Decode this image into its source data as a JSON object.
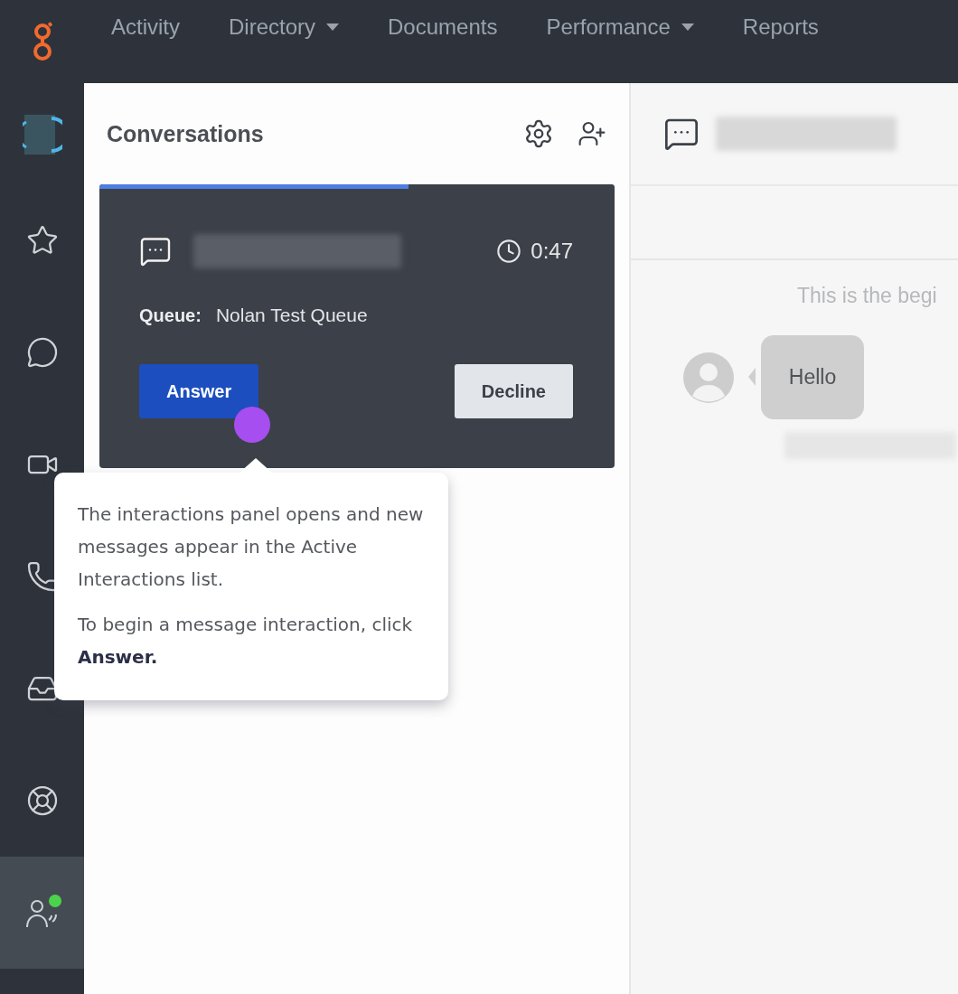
{
  "top_nav": {
    "items": [
      {
        "label": "Activity",
        "has_menu": false
      },
      {
        "label": "Directory",
        "has_menu": true
      },
      {
        "label": "Documents",
        "has_menu": false
      },
      {
        "label": "Performance",
        "has_menu": true
      },
      {
        "label": "Reports",
        "has_menu": false
      }
    ]
  },
  "side_rail": {
    "items": [
      {
        "kind": "star",
        "selected": false
      },
      {
        "kind": "chat",
        "selected": false
      },
      {
        "kind": "video",
        "selected": false
      },
      {
        "kind": "phone",
        "selected": false
      },
      {
        "kind": "inbox",
        "selected": false
      },
      {
        "kind": "help",
        "selected": false
      },
      {
        "kind": "agent",
        "selected": true,
        "color": "#4cd34c"
      }
    ]
  },
  "conversations": {
    "title": "Conversations",
    "alert": {
      "level": 0.6,
      "timer": "0:47",
      "queue_label": "Queue:",
      "queue_name": "Nolan Test Queue",
      "answer": "Answer",
      "decline": "Decline"
    }
  },
  "tooltip": {
    "paragraphs": [
      "The interactions panel opens and new messages appear in the Active Interactions list.",
      "To begin a message interaction, click **Answer.**"
    ]
  },
  "transcript": {
    "intro": "This is the begi",
    "messages": [
      {
        "text": "Hello"
      }
    ]
  }
}
